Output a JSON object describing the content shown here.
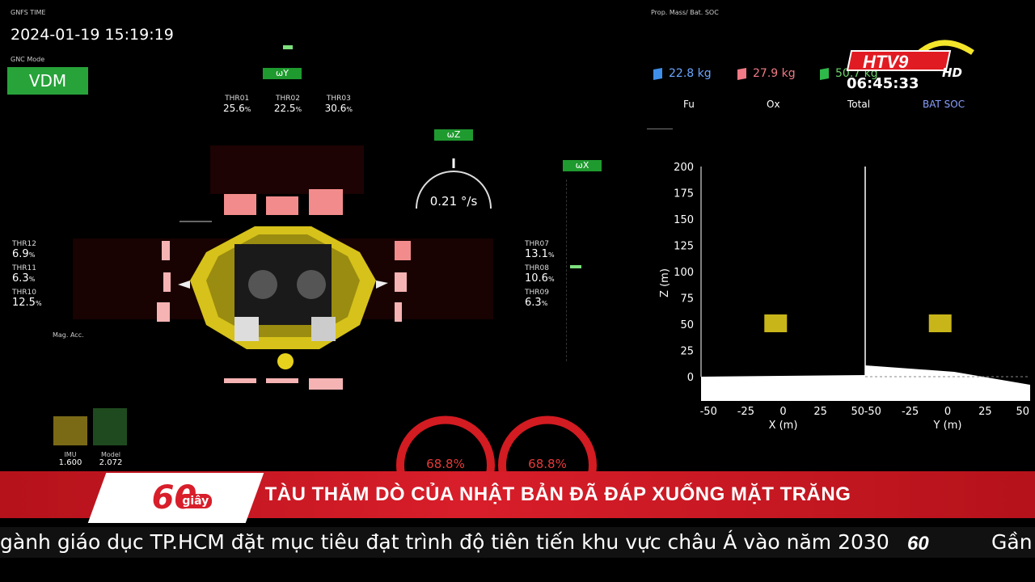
{
  "gnss": {
    "label": "GNFS TIME",
    "datetime": "2024-01-19 15:19:19"
  },
  "gnc_mode": {
    "label": "GNC Mode",
    "value": "VDM"
  },
  "rates": {
    "wy": "ωY",
    "wz": "ωZ",
    "wx": "ωX",
    "wz_value": "0.21 °/s"
  },
  "thrusters_top": [
    {
      "label": "THR01",
      "value": "25.6",
      "unit": "%"
    },
    {
      "label": "THR02",
      "value": "22.5",
      "unit": "%"
    },
    {
      "label": "THR03",
      "value": "30.6",
      "unit": "%"
    }
  ],
  "thrusters_left": [
    {
      "label": "THR12",
      "value": "6.9",
      "unit": "%"
    },
    {
      "label": "THR11",
      "value": "6.3",
      "unit": "%"
    },
    {
      "label": "THR10",
      "value": "12.5",
      "unit": "%"
    }
  ],
  "thrusters_right": [
    {
      "label": "THR07",
      "value": "13.1",
      "unit": "%"
    },
    {
      "label": "THR08",
      "value": "10.6",
      "unit": "%"
    },
    {
      "label": "THR09",
      "value": "6.3",
      "unit": "%"
    }
  ],
  "mag_acc": {
    "label": "Mag. Acc.",
    "imu_label": "IMU",
    "imu_value": "1.600",
    "model_label": "Model",
    "model_value": "2.072"
  },
  "gauges": [
    {
      "value": "68.8%"
    },
    {
      "value": "68.8%"
    }
  ],
  "propellant": {
    "title": "Prop. Mass/ Bat. SOC",
    "fu": {
      "value": "22.8 kg",
      "label": "Fu",
      "color": "#3f8fe8"
    },
    "ox": {
      "value": "27.9 kg",
      "label": "Ox",
      "color": "#f07a86"
    },
    "total": {
      "value": "50.7 kg",
      "label": "Total",
      "color": "#2fb84a"
    },
    "bat_label": "BAT SOC",
    "bat_color": "#8aa0ff"
  },
  "channel": {
    "logo": "HTV9",
    "hd": "HD",
    "clock": "06:45:33"
  },
  "chart_data": {
    "type": "scatter",
    "panels": [
      {
        "xlabel": "X (m)",
        "ylabel": "Z (m)",
        "xticks": [
          -50,
          -25,
          0,
          25,
          50
        ],
        "yticks": [
          0,
          25,
          50,
          75,
          100,
          125,
          150,
          175,
          200
        ],
        "lander": {
          "x": -5,
          "z": 50
        }
      },
      {
        "xlabel": "Y (m)",
        "ylabel": "",
        "xticks": [
          -50,
          -25,
          0,
          25,
          50
        ],
        "yticks": [],
        "lander": {
          "x": -5,
          "z": 50
        }
      }
    ],
    "ylim": [
      0,
      200
    ],
    "xlim": [
      -55,
      55
    ]
  },
  "news": {
    "brand": "60",
    "brand_sub": "giây",
    "headline": "TÀU THĂM DÒ CỦA NHẬT BẢN ĐÃ ĐÁP XUỐNG MẶT TRĂNG",
    "ticker": "gành giáo dục TP.HCM đặt mục tiêu đạt trình độ tiên tiến khu vực châu Á vào năm 2030",
    "ticker_next": "Gần"
  }
}
